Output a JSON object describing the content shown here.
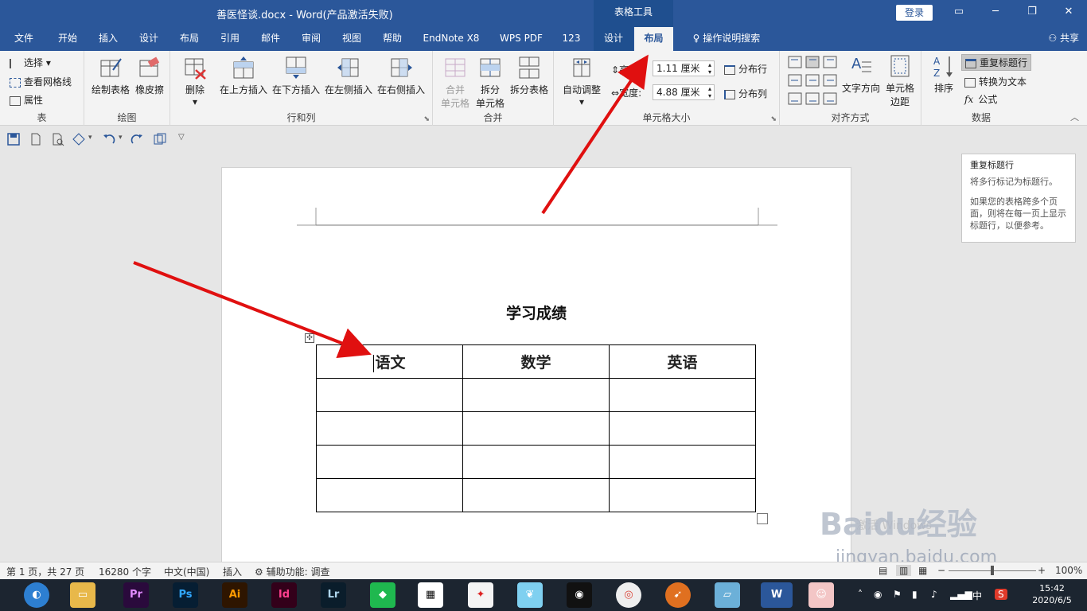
{
  "window": {
    "title": "善医怪谈.docx  -  Word(产品激活失败)",
    "contextual_group": "表格工具",
    "login": "登录",
    "restore_ribbon_icon": "ribbon-display-icon",
    "minimize": "─",
    "maximize": "❐",
    "close": "✕"
  },
  "tabs": [
    "文件",
    "开始",
    "插入",
    "设计",
    "布局",
    "引用",
    "邮件",
    "审阅",
    "视图",
    "帮助",
    "EndNote X8",
    "WPS PDF",
    "123",
    "设计",
    "布局"
  ],
  "tell_me": "操作说明搜索",
  "share": "共享",
  "ribbon": {
    "table_group": {
      "label": "表",
      "select": "选择",
      "view_gridlines": "查看网格线",
      "properties": "属性"
    },
    "draw_group": {
      "label": "绘图",
      "draw_table": "绘制表格",
      "eraser": "橡皮擦"
    },
    "rows_cols_group": {
      "label": "行和列",
      "delete": "删除",
      "insert_above": "在上方插入",
      "insert_below": "在下方插入",
      "insert_left": "在左侧插入",
      "insert_right": "在右侧插入"
    },
    "merge_group": {
      "label": "合并",
      "merge_cells_1": "合并",
      "merge_cells_2": "单元格",
      "split_cells_1": "拆分",
      "split_cells_2": "单元格",
      "split_table": "拆分表格"
    },
    "cell_size_group": {
      "label": "单元格大小",
      "autofit": "自动调整",
      "height_label": "高度:",
      "height_value": "1.11 厘米",
      "width_label": "宽度:",
      "width_value": "4.88 厘米",
      "distribute_rows": "分布行",
      "distribute_cols": "分布列"
    },
    "alignment_group": {
      "label": "对齐方式",
      "text_direction": "文字方向",
      "cell_margins_1": "单元格",
      "cell_margins_2": "边距"
    },
    "data_group": {
      "label": "数据",
      "sort": "排序",
      "repeat_header": "重复标题行",
      "convert_to_text": "转换为文本",
      "formula": "公式"
    }
  },
  "tooltip": {
    "title": "重复标题行",
    "line1": "将多行标记为标题行。",
    "line2": "如果您的表格跨多个页面，则将在每一页上显示标题行，以便参考。"
  },
  "document": {
    "heading": "学习成绩",
    "table_headers": [
      "语文",
      "数学",
      "英语"
    ],
    "empty_rows": 4
  },
  "statusbar": {
    "page": "第 1 页，共 27 页",
    "words": "16280 个字",
    "language": "中文(中国)",
    "mode": "插入",
    "accessibility": "辅助功能: 调查",
    "zoom": "100%"
  },
  "watermark": {
    "activate": "激活 Windows",
    "brand": "Baidu经验",
    "url": "jingyan.baidu.com"
  },
  "taskbar": {
    "apps": [
      "Pr",
      "Ps",
      "Ai",
      "Id",
      "Lr",
      "W"
    ],
    "ime": "中",
    "time": "15:42",
    "date": "2020/6/5"
  },
  "colors": {
    "word_blue": "#2b579a",
    "arrow_red": "#e01010"
  }
}
